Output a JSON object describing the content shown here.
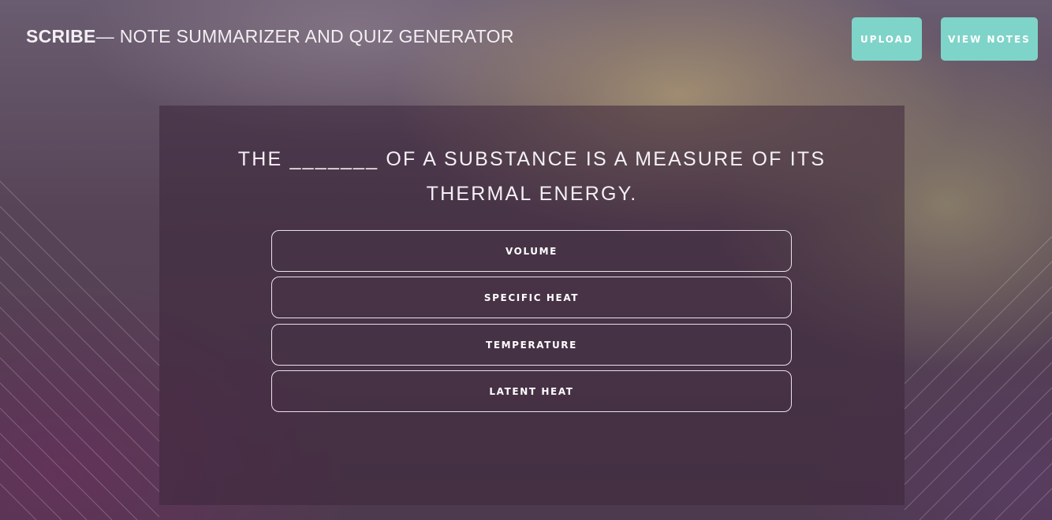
{
  "header": {
    "brand_name": "SCRIBE",
    "brand_tagline": "— NOTE SUMMARIZER AND QUIZ GENERATOR",
    "buttons": {
      "upload": "UPLOAD",
      "view_notes": "VIEW NOTES"
    }
  },
  "quiz": {
    "question": "THE _______ OF A SUBSTANCE IS A MEASURE OF ITS THERMAL ENERGY.",
    "options": [
      "VOLUME",
      "SPECIFIC HEAT",
      "TEMPERATURE",
      "LATENT HEAT"
    ]
  },
  "colors": {
    "accent": "#7fd4c9",
    "panel": "#3c263a",
    "text": "#f4f0f4"
  }
}
